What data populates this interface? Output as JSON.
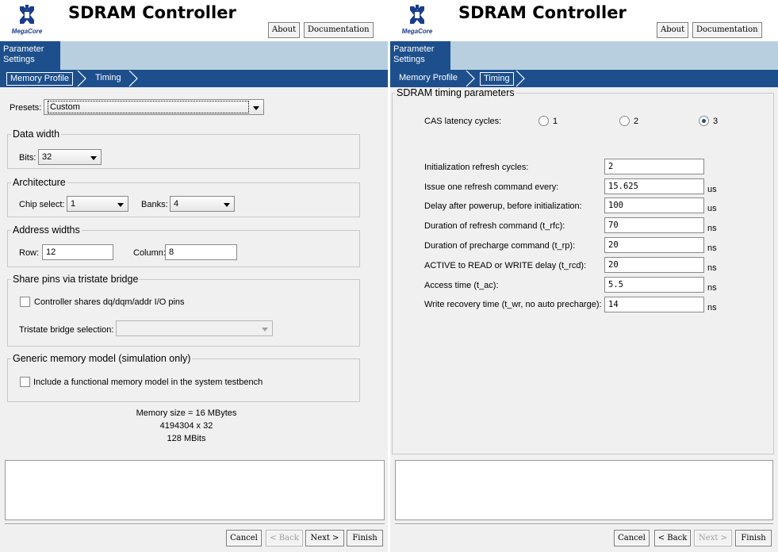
{
  "left": {
    "header": {
      "logo_text": "MegaCore",
      "title": "SDRAM Controller",
      "about": "About",
      "documentation": "Documentation"
    },
    "param_tab": {
      "line1": "Parameter",
      "line2": "Settings"
    },
    "nav": {
      "memory_profile": "Memory Profile",
      "timing": "Timing"
    },
    "presets": {
      "label": "Presets:",
      "value": "Custom"
    },
    "data_width": {
      "title": "Data width",
      "bits_label": "Bits:",
      "bits_value": "32"
    },
    "architecture": {
      "title": "Architecture",
      "chip_select_label": "Chip select:",
      "chip_select_value": "1",
      "banks_label": "Banks:",
      "banks_value": "4"
    },
    "address_widths": {
      "title": "Address widths",
      "row_label": "Row:",
      "row_value": "12",
      "column_label": "Column:",
      "column_value": "8"
    },
    "tristate": {
      "title": "Share pins via tristate bridge",
      "checkbox_label": "Controller shares dq/dqm/addr I/O pins",
      "bridge_label": "Tristate bridge selection:",
      "bridge_value": ""
    },
    "memory_model": {
      "title": "Generic memory model (simulation only)",
      "checkbox_label": "Include a functional memory model in the system testbench"
    },
    "summary": {
      "line1": "Memory size = 16 MBytes",
      "line2": "4194304 x 32",
      "line3": "128 MBits"
    },
    "footer": {
      "cancel": "Cancel",
      "back": "< Back",
      "next": "Next >",
      "finish": "Finish"
    }
  },
  "right": {
    "header": {
      "logo_text": "MegaCore",
      "title": "SDRAM Controller",
      "about": "About",
      "documentation": "Documentation"
    },
    "param_tab": {
      "line1": "Parameter",
      "line2": "Settings"
    },
    "nav": {
      "memory_profile": "Memory Profile",
      "timing": "Timing"
    },
    "timing": {
      "title": "SDRAM timing parameters",
      "cas_label": "CAS latency cycles:",
      "cas_options": [
        "1",
        "2",
        "3"
      ],
      "cas_selected": "3",
      "rows": [
        {
          "label": "Initialization refresh cycles:",
          "value": "2",
          "unit": ""
        },
        {
          "label": "Issue one refresh command every:",
          "value": "15.625",
          "unit": "us"
        },
        {
          "label": "Delay after powerup, before initialization:",
          "value": "100",
          "unit": "us"
        },
        {
          "label": "Duration of refresh command (t_rfc):",
          "value": "70",
          "unit": "ns"
        },
        {
          "label": "Duration of precharge command (t_rp):",
          "value": "20",
          "unit": "ns"
        },
        {
          "label": "ACTIVE to READ or WRITE delay (t_rcd):",
          "value": "20",
          "unit": "ns"
        },
        {
          "label": "Access time (t_ac):",
          "value": "5.5",
          "unit": "ns"
        },
        {
          "label": "Write recovery time (t_wr, no auto precharge):",
          "value": "14",
          "unit": "ns"
        }
      ]
    },
    "footer": {
      "cancel": "Cancel",
      "back": "< Back",
      "next": "Next >",
      "finish": "Finish"
    }
  },
  "colors": {
    "nav_blue": "#1d4f8c",
    "tab_light_blue": "#b8cfe0",
    "panel_bg": "#f0f0f0"
  },
  "icons": {
    "logo": "megacore-logo-icon",
    "dropdown": "chevron-down-icon",
    "breadcrumb_separator": "chevron-right-icon"
  }
}
